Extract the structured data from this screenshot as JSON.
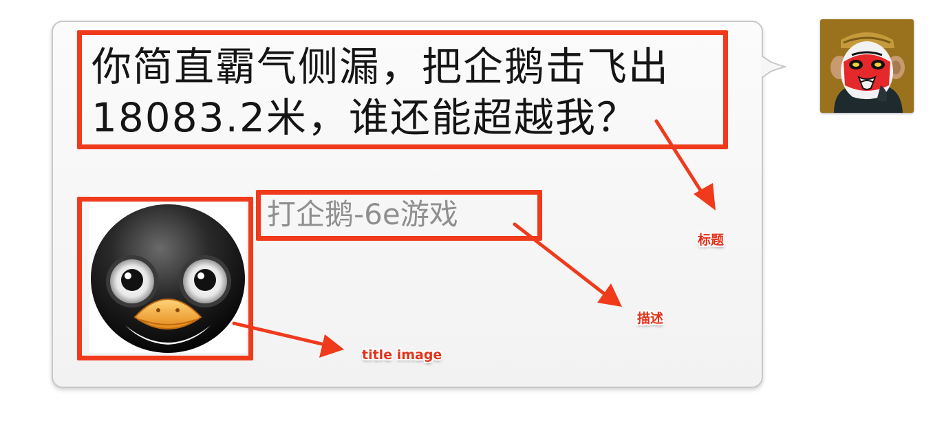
{
  "message": {
    "title": "你简直霸气侧漏，把企鹅击飞出18083.2米，谁还能超越我？",
    "description": "打企鹅-6e游戏",
    "title_image_icon": "penguin-icon"
  },
  "sender": {
    "avatar_icon": "monkey-king-opera-mask-icon"
  },
  "annotations": {
    "title_label": "标题",
    "description_label": "描述",
    "image_label": "title image",
    "highlight_color": "#f03a1c"
  },
  "colors": {
    "bubble_border": "#c8c8c8",
    "title_text": "#151515",
    "description_text": "#8f8f8f"
  }
}
